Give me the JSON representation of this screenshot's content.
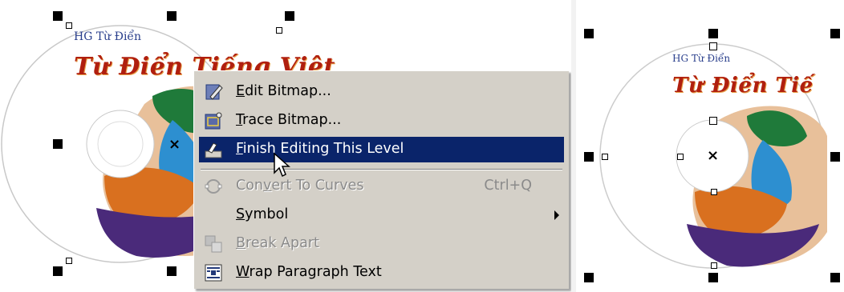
{
  "left_panel": {
    "cd": {
      "small_label": "HG Từ Điển",
      "title": "Từ Điển Tiếng Việt"
    },
    "context_menu": {
      "items": [
        {
          "label_pre": "",
          "label_ul": "E",
          "label_post": "dit Bitmap...",
          "icon": "edit-bitmap-icon",
          "shortcut": "",
          "state": "normal"
        },
        {
          "label_pre": "",
          "label_ul": "T",
          "label_post": "race Bitmap...",
          "icon": "trace-bitmap-icon",
          "shortcut": "",
          "state": "normal"
        },
        {
          "label_pre": "",
          "label_ul": "F",
          "label_post": "inish Editing This Level",
          "icon": "finish-editing-icon",
          "shortcut": "",
          "state": "selected"
        },
        {
          "label_pre": "Con",
          "label_ul": "v",
          "label_post": "ert To Curves",
          "icon": "convert-curves-icon",
          "shortcut": "Ctrl+Q",
          "state": "disabled"
        },
        {
          "label_pre": "",
          "label_ul": "S",
          "label_post": "ymbol",
          "icon": "",
          "shortcut": "",
          "state": "submenu"
        },
        {
          "label_pre": "",
          "label_ul": "B",
          "label_post": "reak Apart",
          "icon": "break-apart-icon",
          "shortcut": "",
          "state": "disabled"
        },
        {
          "label_pre": "",
          "label_ul": "W",
          "label_post": "rap Paragraph Text",
          "icon": "wrap-paragraph-icon",
          "shortcut": "",
          "state": "normal"
        }
      ]
    }
  },
  "right_panel": {
    "cd": {
      "small_label": "HG Từ Điển",
      "title": "Từ Điển Tiế"
    }
  },
  "colors": {
    "menu_bg": "#d4d0c8",
    "menu_highlight": "#0a246a",
    "title_red": "#b01f0f",
    "label_blue": "#2a3f8c"
  }
}
